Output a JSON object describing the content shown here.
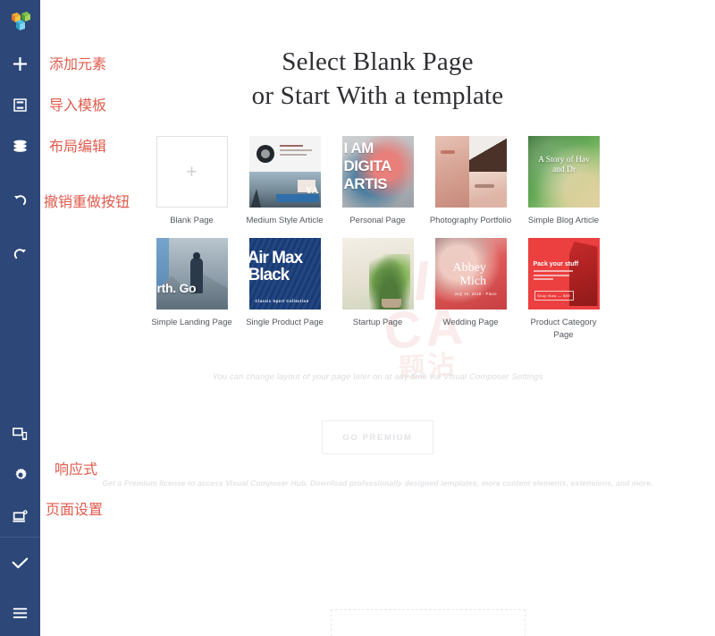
{
  "sidebar": {
    "logo": {
      "name": "visual-composer-logo"
    },
    "items": [
      {
        "id": "add-element",
        "icon": "plus-icon",
        "annotation": "添加元素"
      },
      {
        "id": "import-template",
        "icon": "template-icon",
        "annotation": "导入模板"
      },
      {
        "id": "layout-edit",
        "icon": "layers-icon",
        "annotation": "布局编辑"
      },
      {
        "id": "undo",
        "icon": "undo-icon",
        "annotation": "撤销重做按钮"
      },
      {
        "id": "redo",
        "icon": "redo-icon",
        "annotation": ""
      },
      {
        "id": "responsive",
        "icon": "responsive-icon",
        "annotation": "响应式"
      },
      {
        "id": "page-settings",
        "icon": "gear-icon",
        "annotation": "页面设置"
      },
      {
        "id": "hub",
        "icon": "hub-download-icon",
        "annotation": ""
      },
      {
        "id": "publish",
        "icon": "check-icon",
        "annotation": ""
      },
      {
        "id": "menu",
        "icon": "hamburger-icon",
        "annotation": ""
      }
    ],
    "background_color": "#2c4778",
    "annotation_color": "#e05b4d"
  },
  "main": {
    "heading_line1": "Select Blank Page",
    "heading_line2": "or Start With a template",
    "hint": "You can change layout of your page later on at any time via Visual Composer Settings",
    "premium_button": "GO PREMIUM",
    "premium_note": "Get a Premium license to access Visual Composer Hub. Download professionally designed templates, more content elements, extensions, and more."
  },
  "watermark": {
    "line1": "VIP",
    "line2": "CA",
    "line3": "题沾"
  },
  "templates": [
    {
      "id": "blank-page",
      "label": "Blank Page",
      "art": "blank"
    },
    {
      "id": "medium-style-article",
      "label": "Medium Style Article",
      "art": "medium"
    },
    {
      "id": "personal-page",
      "label": "Personal Page",
      "art": "personal",
      "text": {
        "l1": "I AM",
        "l2": "DIGITA",
        "l3": "ARTIS"
      }
    },
    {
      "id": "photography-portfolio",
      "label": "Photography Portfolio",
      "art": "photo"
    },
    {
      "id": "simple-blog-article",
      "label": "Simple Blog Article",
      "art": "blog",
      "text": {
        "l1": "A Story of Hav",
        "l2": "and Dr"
      }
    },
    {
      "id": "simple-landing-page",
      "label": "Simple Landing Page",
      "art": "landing",
      "text": {
        "l1": "rth. Go"
      }
    },
    {
      "id": "single-product-page",
      "label": "Single Product Page",
      "art": "product",
      "text": {
        "l1": "Air Max",
        "l2": "Black",
        "l3": "Classic Sport Collection"
      }
    },
    {
      "id": "startup-page",
      "label": "Startup Page",
      "art": "startup"
    },
    {
      "id": "wedding-page",
      "label": "Wedding Page",
      "art": "wedding",
      "text": {
        "l1": "Abbey",
        "l2": "Mich",
        "l3": "July 15, 2018  ·  Place"
      }
    },
    {
      "id": "product-category-page",
      "label": "Product Category Page",
      "art": "cat",
      "text": {
        "l1": "Pack your stuff",
        "l2": "Shop Now — $99"
      }
    }
  ]
}
